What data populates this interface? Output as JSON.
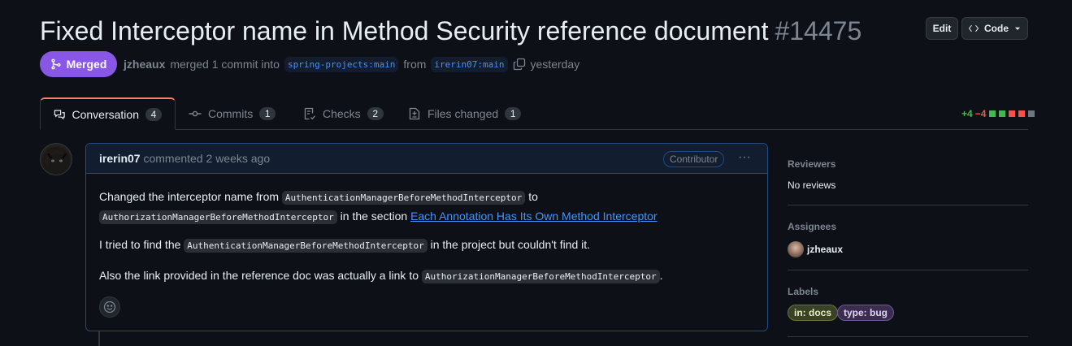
{
  "header": {
    "title": "Fixed Interceptor name in Method Security reference document",
    "number": "#14475",
    "edit_label": "Edit",
    "code_label": "Code"
  },
  "meta": {
    "status": "Merged",
    "author": "jzheaux",
    "action": "merged 1 commit into",
    "base_branch": "spring-projects:main",
    "from_word": "from",
    "head_branch": "irerin07:main",
    "time": "yesterday"
  },
  "tabs": [
    {
      "label": "Conversation",
      "count": "4"
    },
    {
      "label": "Commits",
      "count": "1"
    },
    {
      "label": "Checks",
      "count": "2"
    },
    {
      "label": "Files changed",
      "count": "1"
    }
  ],
  "diffstat": {
    "additions": "+4",
    "deletions": "−4"
  },
  "comment": {
    "author": "irerin07",
    "action": "commented 2 weeks ago",
    "badge": "Contributor",
    "p1_a": "Changed the interceptor name from",
    "p1_code1": "AuthenticationManagerBeforeMethodInterceptor",
    "p1_b": "to",
    "p1_code2": "AuthorizationManagerBeforeMethodInterceptor",
    "p1_c": "in the section",
    "p1_link": "Each Annotation Has Its Own Method Interceptor",
    "p2_a": "I tried to find the",
    "p2_code": "AuthenticationManagerBeforeMethodInterceptor",
    "p2_b": "in the project but couldn't find it.",
    "p3_a": "Also the link provided in the reference doc was actually a link to",
    "p3_code": "AuthorizationManagerBeforeMethodInterceptor",
    "p3_b": "."
  },
  "sidebar": {
    "reviewers_label": "Reviewers",
    "reviewers_value": "No reviews",
    "assignees_label": "Assignees",
    "assignee": "jzheaux",
    "labels_label": "Labels",
    "labels": [
      "in: docs",
      "type: bug"
    ]
  },
  "colors": {
    "merged": "#8957e5",
    "link": "#4493f8",
    "add": "#3fb950",
    "del": "#f85149"
  }
}
